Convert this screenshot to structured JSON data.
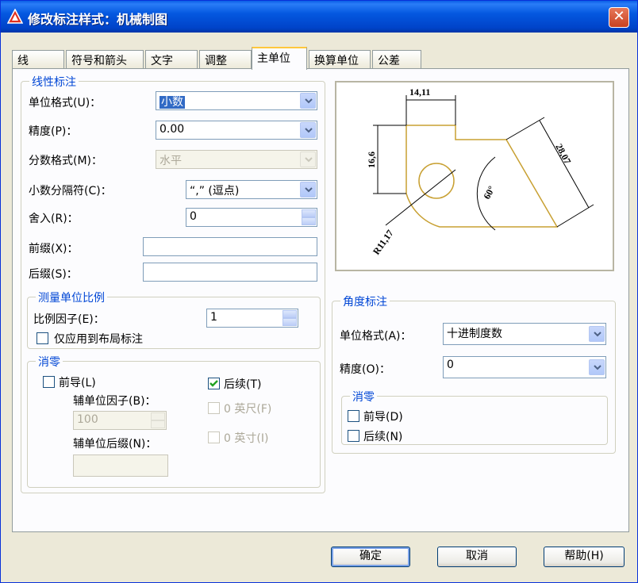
{
  "window": {
    "title": "修改标注样式：机械制图",
    "close_label": "✕"
  },
  "tabs": [
    {
      "label": "线"
    },
    {
      "label": "符号和箭头"
    },
    {
      "label": "文字"
    },
    {
      "label": "调整"
    },
    {
      "label": "主单位"
    },
    {
      "label": "换算单位"
    },
    {
      "label": "公差"
    }
  ],
  "linear": {
    "title": "线性标注",
    "unit_format_label": "单位格式(U)：",
    "unit_format_value": "小数",
    "precision_label": "精度(P)：",
    "precision_value": "0.00",
    "fraction_format_label": "分数格式(M)：",
    "fraction_format_value": "水平",
    "decimal_sep_label": "小数分隔符(C)：",
    "decimal_sep_value": "“,”  (逗点)",
    "round_off_label": "舍入(R)：",
    "round_off_value": "0",
    "prefix_label": "前缀(X)：",
    "prefix_value": "",
    "suffix_label": "后缀(S)：",
    "suffix_value": ""
  },
  "scale": {
    "title": "测量单位比例",
    "factor_label": "比例因子(E)：",
    "factor_value": "1",
    "layout_only_label": "仅应用到布局标注"
  },
  "zero_linear": {
    "title": "消零",
    "leading_label": "前导(L)",
    "trailing_label": "后续(T)",
    "sub_factor_label": "辅单位因子(B)：",
    "sub_factor_value": "100",
    "sub_suffix_label": "辅单位后缀(N)：",
    "sub_suffix_value": "",
    "feet_label": "0 英尺(F)",
    "inches_label": "0 英寸(I)"
  },
  "angular": {
    "title": "角度标注",
    "unit_format_label": "单位格式(A)：",
    "unit_format_value": "十进制度数",
    "precision_label": "精度(O)：",
    "precision_value": "0",
    "zero_title": "消零",
    "leading_label": "前导(D)",
    "trailing_label": "后续(N)"
  },
  "preview": {
    "dim_top": "14,11",
    "dim_left": "16,6",
    "dim_diag": "28,07",
    "dim_angle": "60°",
    "dim_radius": "R11,17"
  },
  "buttons": {
    "ok": "确定",
    "cancel": "取消",
    "help": "帮助(H)"
  },
  "colors": {
    "titlebar": "#0054e3",
    "group_title": "#0046d5",
    "selection": "#316ac5",
    "part_outline": "#c8a032"
  }
}
